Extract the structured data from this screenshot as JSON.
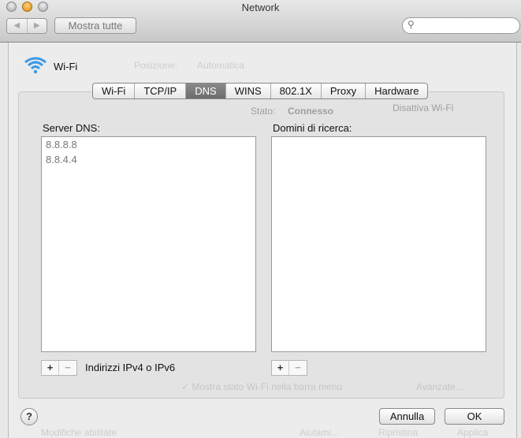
{
  "window": {
    "title": "Network"
  },
  "toolbar": {
    "back": "◀",
    "forward": "▶",
    "show_all": "Mostra tutte",
    "search_placeholder": ""
  },
  "background": {
    "location_label": "Posizione:",
    "location_value": "Automatica",
    "status_label": "Stato:",
    "status_value": "Connesso",
    "turn_off": "Disattiva Wi-Fi",
    "show_status": "✓ Mostra stato Wi-Fi nella barra menu",
    "advanced": "Avanzate...",
    "lock": "Modifiche abilitate",
    "assist": "Aiutami...",
    "revert": "Ripristina",
    "apply": "Applica"
  },
  "sheet": {
    "interface_name": "Wi-Fi",
    "tabs": [
      {
        "label": "Wi-Fi"
      },
      {
        "label": "TCP/IP"
      },
      {
        "label": "DNS",
        "active": true
      },
      {
        "label": "WINS"
      },
      {
        "label": "802.1X"
      },
      {
        "label": "Proxy"
      },
      {
        "label": "Hardware"
      }
    ],
    "dns_label": "Server DNS:",
    "dns_servers": [
      "8.8.8.8",
      "8.8.4.4"
    ],
    "search_label": "Domini di ricerca:",
    "search_domains": [],
    "plus": "+",
    "minus": "−",
    "dns_hint": "Indirizzi IPv4 o IPv6",
    "help": "?",
    "cancel": "Annulla",
    "ok": "OK"
  },
  "colors": {
    "active_tab": "#767676",
    "wifi_icon": "#3a9ae8"
  }
}
